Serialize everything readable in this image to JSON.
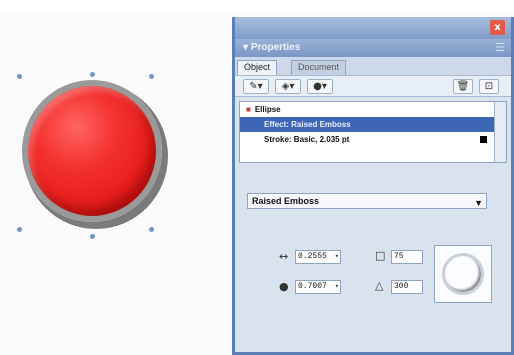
{
  "panel": {
    "title": "Properties",
    "close_label": "x",
    "menu_icon": "panel-menu-icon",
    "tabs": [
      {
        "label": "Object",
        "active": true
      },
      {
        "label": "Document",
        "active": false
      }
    ],
    "toolbar": {
      "stroke_btn": "✎▾",
      "fill_btn": "◈▾",
      "effect_btn": "●▾",
      "trash_btn": "🗑",
      "del_btn": "⊡"
    },
    "list_items": [
      {
        "label": "Ellipse",
        "selected": false
      },
      {
        "label": "Effect: Raised Emboss",
        "selected": true
      },
      {
        "label": "Stroke: Basic, 2.035 pt",
        "selected": false
      },
      {
        "label": "",
        "selected": false
      }
    ],
    "effect_select": "Raised Emboss",
    "width_value": "0.2555",
    "softness_value": "0.7007",
    "opacity_value": "75",
    "angle_value": "300"
  },
  "colors": {
    "button_red": "#e41b1b",
    "panel_blue": "#5b7eb7",
    "selection": "#3d66b5"
  }
}
